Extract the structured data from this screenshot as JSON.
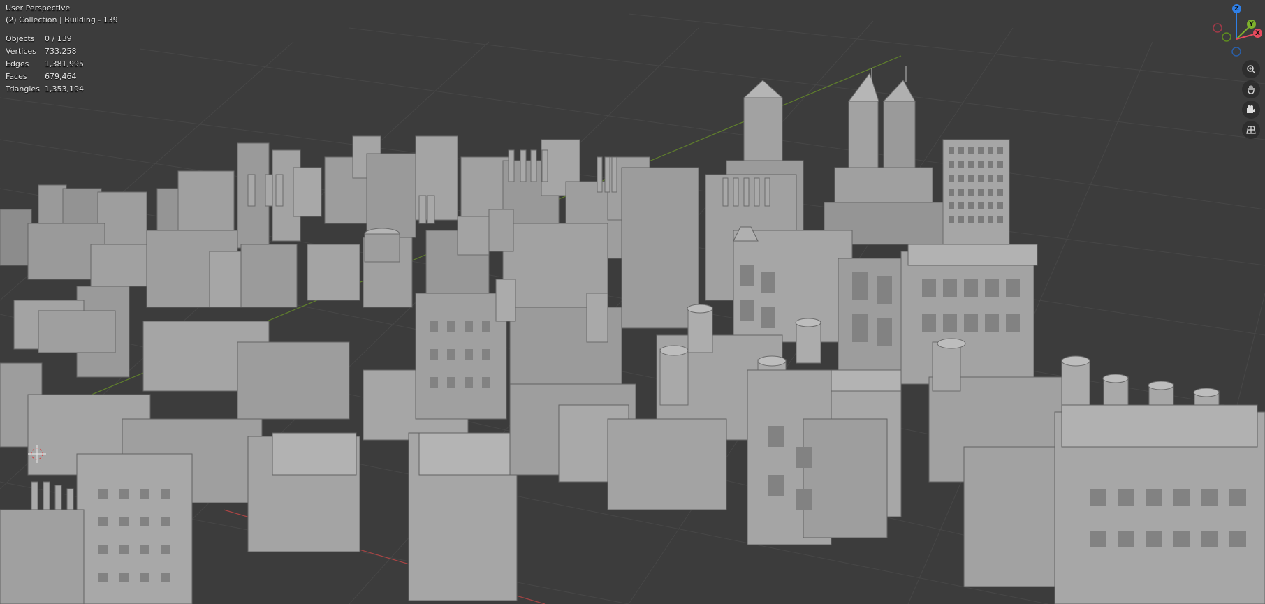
{
  "viewport": {
    "view_name": "User Perspective",
    "collection_info": "(2) Collection | Building - 139"
  },
  "stats": [
    {
      "label": "Objects",
      "value": "0 / 139"
    },
    {
      "label": "Vertices",
      "value": "733,258"
    },
    {
      "label": "Edges",
      "value": "1,381,995"
    },
    {
      "label": "Faces",
      "value": "679,464"
    },
    {
      "label": "Triangles",
      "value": "1,353,194"
    }
  ],
  "gizmo": {
    "z_label": "Z",
    "y_label": "Y",
    "x_label": "X",
    "colors": {
      "x": "#e64b5e",
      "y": "#7fb22c",
      "z": "#2f7fe6"
    }
  },
  "nav_icons": [
    "zoom-icon",
    "hand-pan-icon",
    "camera-icon",
    "grid-ortho-icon"
  ],
  "theme": {
    "background": "#3c3c3c",
    "grid": "#4a4a4a",
    "axis_x": "#b54646",
    "axis_y": "#6d8f2e",
    "building_light": "#a9a9a9",
    "building_mid": "#8f8f8f",
    "building_dark": "#6e6e6e"
  }
}
